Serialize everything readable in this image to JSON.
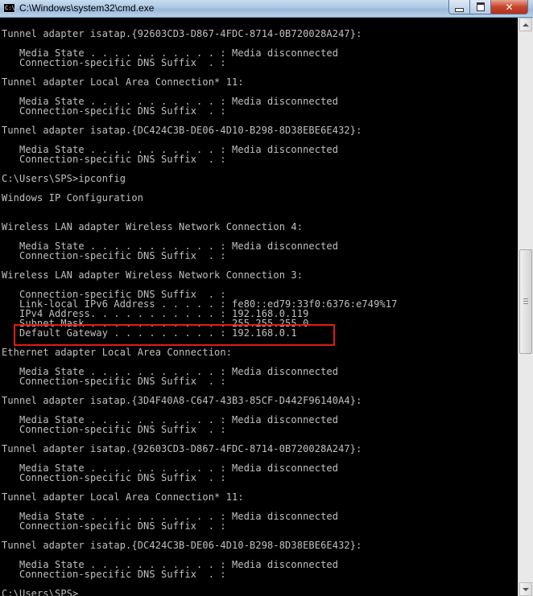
{
  "window": {
    "title": "C:\\Windows\\system32\\cmd.exe",
    "icon_label": "C:\\",
    "close_glyph": "✕"
  },
  "console_lines": [
    "Tunnel adapter isatap.{92603CD3-D867-4FDC-8714-0B720028A247}:",
    "",
    "   Media State . . . . . . . . . . . : Media disconnected",
    "   Connection-specific DNS Suffix  . :",
    "",
    "Tunnel adapter Local Area Connection* 11:",
    "",
    "   Media State . . . . . . . . . . . : Media disconnected",
    "   Connection-specific DNS Suffix  . :",
    "",
    "Tunnel adapter isatap.{DC424C3B-DE06-4D10-B298-8D38EBE6E432}:",
    "",
    "   Media State . . . . . . . . . . . : Media disconnected",
    "   Connection-specific DNS Suffix  . :",
    "",
    "C:\\Users\\SPS>ipconfig",
    "",
    "Windows IP Configuration",
    "",
    "",
    "Wireless LAN adapter Wireless Network Connection 4:",
    "",
    "   Media State . . . . . . . . . . . : Media disconnected",
    "   Connection-specific DNS Suffix  . :",
    "",
    "Wireless LAN adapter Wireless Network Connection 3:",
    "",
    "   Connection-specific DNS Suffix  . :",
    "   Link-local IPv6 Address . . . . . : fe80::ed79:33f0:6376:e749%17",
    "   IPv4 Address. . . . . . . . . . . : 192.168.0.119",
    "   Subnet Mask . . . . . . . . . . . : 255.255.255.0",
    "   Default Gateway . . . . . . . . . : 192.168.0.1",
    "",
    "Ethernet adapter Local Area Connection:",
    "",
    "   Media State . . . . . . . . . . . : Media disconnected",
    "   Connection-specific DNS Suffix  . :",
    "",
    "Tunnel adapter isatap.{3D4F40A8-C647-43B3-85CF-D442F96140A4}:",
    "",
    "   Media State . . . . . . . . . . . : Media disconnected",
    "   Connection-specific DNS Suffix  . :",
    "",
    "Tunnel adapter isatap.{92603CD3-D867-4FDC-8714-0B720028A247}:",
    "",
    "   Media State . . . . . . . . . . . : Media disconnected",
    "   Connection-specific DNS Suffix  . :",
    "",
    "Tunnel adapter Local Area Connection* 11:",
    "",
    "   Media State . . . . . . . . . . . : Media disconnected",
    "   Connection-specific DNS Suffix  . :",
    "",
    "Tunnel adapter isatap.{DC424C3B-DE06-4D10-B298-8D38EBE6E432}:",
    "",
    "   Media State . . . . . . . . . . . : Media disconnected",
    "   Connection-specific DNS Suffix  . :",
    "",
    "C:\\Users\\SPS>"
  ],
  "highlight": {
    "line_index": 31,
    "color": "#e21b1b"
  },
  "colors": {
    "console_bg": "#000000",
    "console_text": "#c0c0c0"
  }
}
